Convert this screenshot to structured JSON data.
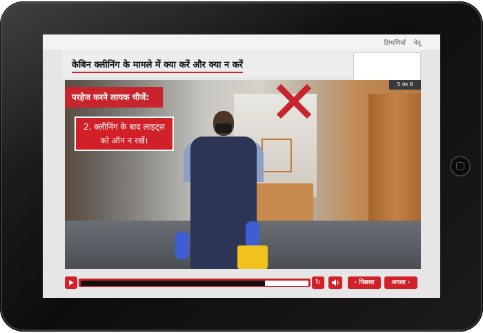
{
  "header": {
    "links": [
      "टिप्पणियाँ",
      "मेनू"
    ],
    "title": "केबिन क्लीनिंग के मामले में क्या करें और क्या न करें"
  },
  "slide": {
    "counter": "5 का 6",
    "section_label": "परहेज करने लायक चीजें:",
    "tip_line1": "2. क्लीनिंग के बाद लाइट्स",
    "tip_line2": "को ऑन न रखें।",
    "x_icon": "x-mark-icon",
    "accent_color": "#d12027"
  },
  "controls": {
    "play_icon": "play-icon",
    "progress": 0.81,
    "replay_icon": "replay-icon",
    "volume_icon": "volume-icon",
    "prev_label": "‹ पिछला",
    "next_label": "अगला ›"
  }
}
